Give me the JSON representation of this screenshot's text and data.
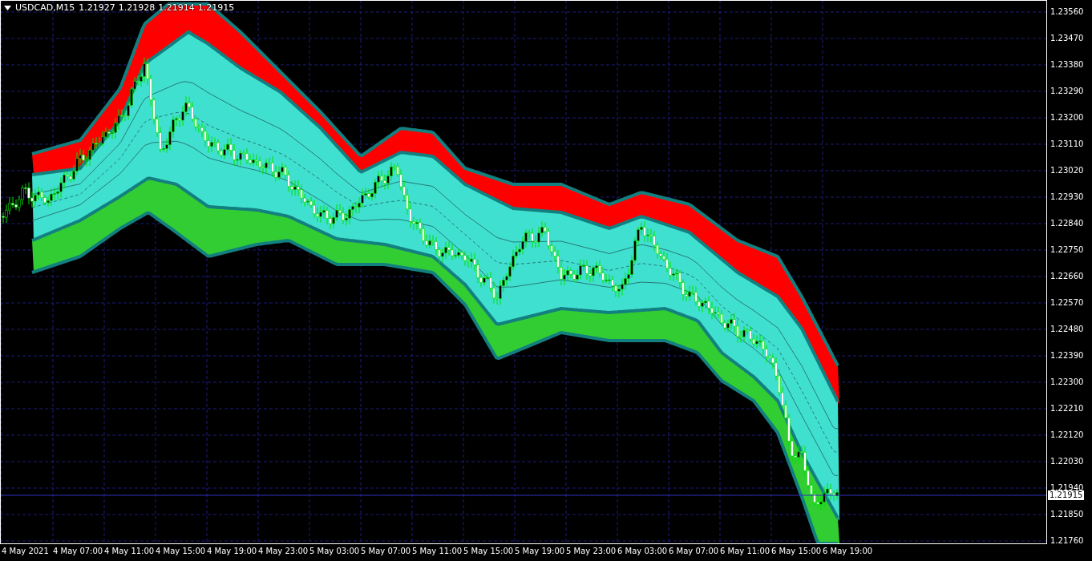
{
  "header": {
    "symbol": "USDCAD,M15",
    "quotes": [
      "1.21927",
      "1.21928",
      "1.21914",
      "1.21915"
    ]
  },
  "price_axis": {
    "labels": [
      "1.23560",
      "1.23470",
      "1.23380",
      "1.23290",
      "1.23200",
      "1.23110",
      "1.23020",
      "1.22930",
      "1.22840",
      "1.22750",
      "1.22660",
      "1.22570",
      "1.22480",
      "1.22390",
      "1.22300",
      "1.22210",
      "1.22120",
      "1.22030",
      "1.21940",
      "1.21850",
      "1.21760"
    ],
    "current_price": "1.21915"
  },
  "time_axis": {
    "labels": [
      "4 May 2021",
      "4 May 07:00",
      "4 May 11:00",
      "4 May 15:00",
      "4 May 19:00",
      "4 May 23:00",
      "5 May 03:00",
      "5 May 07:00",
      "5 May 11:00",
      "5 May 15:00",
      "5 May 19:00",
      "5 May 23:00",
      "6 May 03:00",
      "6 May 07:00",
      "6 May 11:00",
      "6 May 15:00",
      "6 May 19:00"
    ]
  }
}
